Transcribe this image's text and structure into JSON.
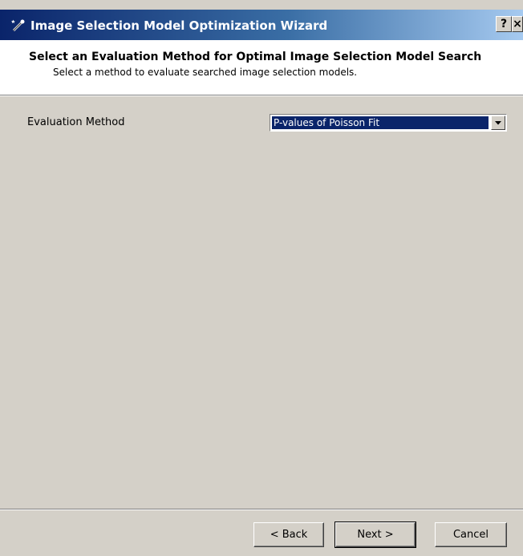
{
  "window": {
    "title": "Image Selection Model Optimization Wizard",
    "icon": "wizard-wand-icon",
    "help_label": "?",
    "close_label": "×"
  },
  "header": {
    "title": "Select an Evaluation Method for Optimal Image Selection Model Search",
    "subtitle": "Select a method to evaluate searched image selection models."
  },
  "form": {
    "evaluation_method_label": "Evaluation Method",
    "evaluation_method_value": "P-values of Poisson Fit"
  },
  "buttons": {
    "back": "< Back",
    "next": "Next >",
    "cancel": "Cancel"
  },
  "colors": {
    "dialog_bg": "#d4d0c8",
    "titlebar_start": "#0a246a",
    "titlebar_end": "#a6caf0",
    "selection": "#0a246a"
  }
}
